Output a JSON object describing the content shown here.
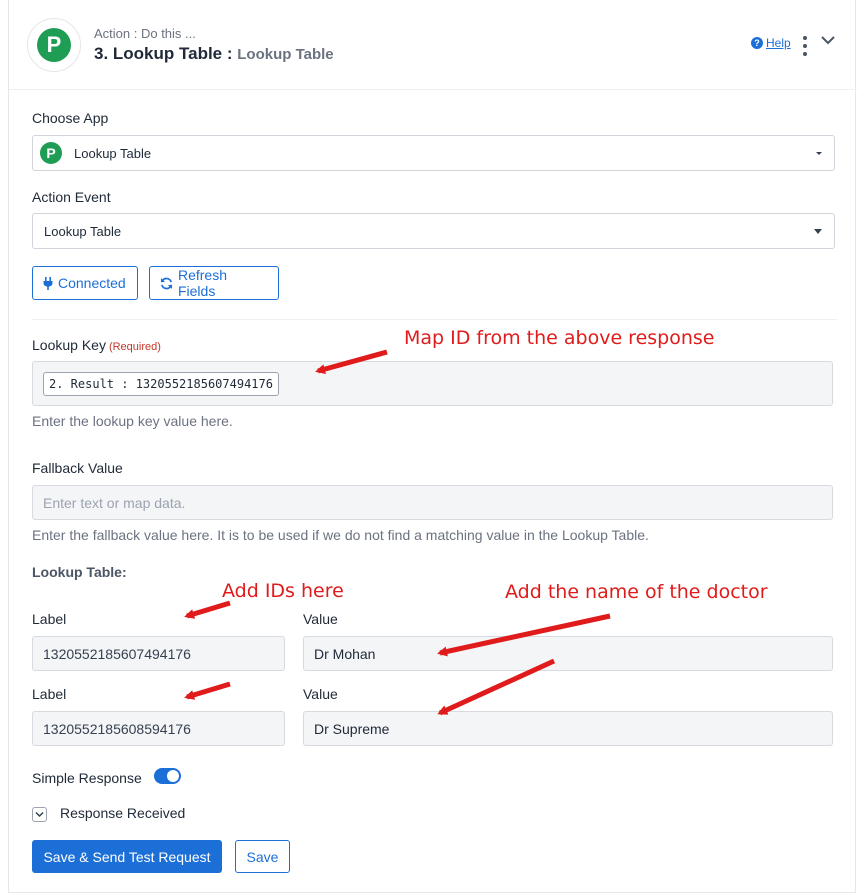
{
  "header": {
    "subtitle": "Action : Do this ...",
    "title_main": "3. Lookup Table :",
    "title_sub": "Lookup Table",
    "help_label": "Help",
    "logo_letter": "P"
  },
  "choose_app": {
    "label": "Choose App",
    "value": "Lookup Table"
  },
  "action_event": {
    "label": "Action Event",
    "value": "Lookup Table"
  },
  "buttons": {
    "connected": "Connected",
    "refresh": "Refresh Fields",
    "save_send": "Save & Send Test Request",
    "save": "Save"
  },
  "lookup_key": {
    "label": "Lookup Key",
    "required": "(Required)",
    "pill": "2. Result : 1320552185607494176",
    "hint": "Enter the lookup key value here."
  },
  "fallback": {
    "label": "Fallback Value",
    "placeholder": "Enter text or map data.",
    "hint": "Enter the fallback value here. It is to be used if we do not find a matching value in the Lookup Table."
  },
  "lookup_table": {
    "title": "Lookup Table:",
    "label_header": "Label",
    "value_header": "Value",
    "rows": [
      {
        "label": "1320552185607494176",
        "value": "Dr Mohan"
      },
      {
        "label": "1320552185608594176",
        "value": "Dr Supreme"
      }
    ]
  },
  "simple_response": {
    "label": "Simple Response",
    "enabled": true
  },
  "response_received": {
    "label": "Response Received"
  },
  "annotations": {
    "map_id": "Map ID from the above response",
    "add_ids": "Add IDs here",
    "add_name": "Add the name of the doctor"
  },
  "colors": {
    "brand_green": "#1f9d55",
    "primary_blue": "#1d6fd8",
    "annotation_red": "#e01b1b"
  },
  "icons": [
    "help-icon",
    "kebab-menu-icon",
    "chevron-down-icon",
    "plug-icon",
    "refresh-icon",
    "checkbox-chevron-icon"
  ]
}
